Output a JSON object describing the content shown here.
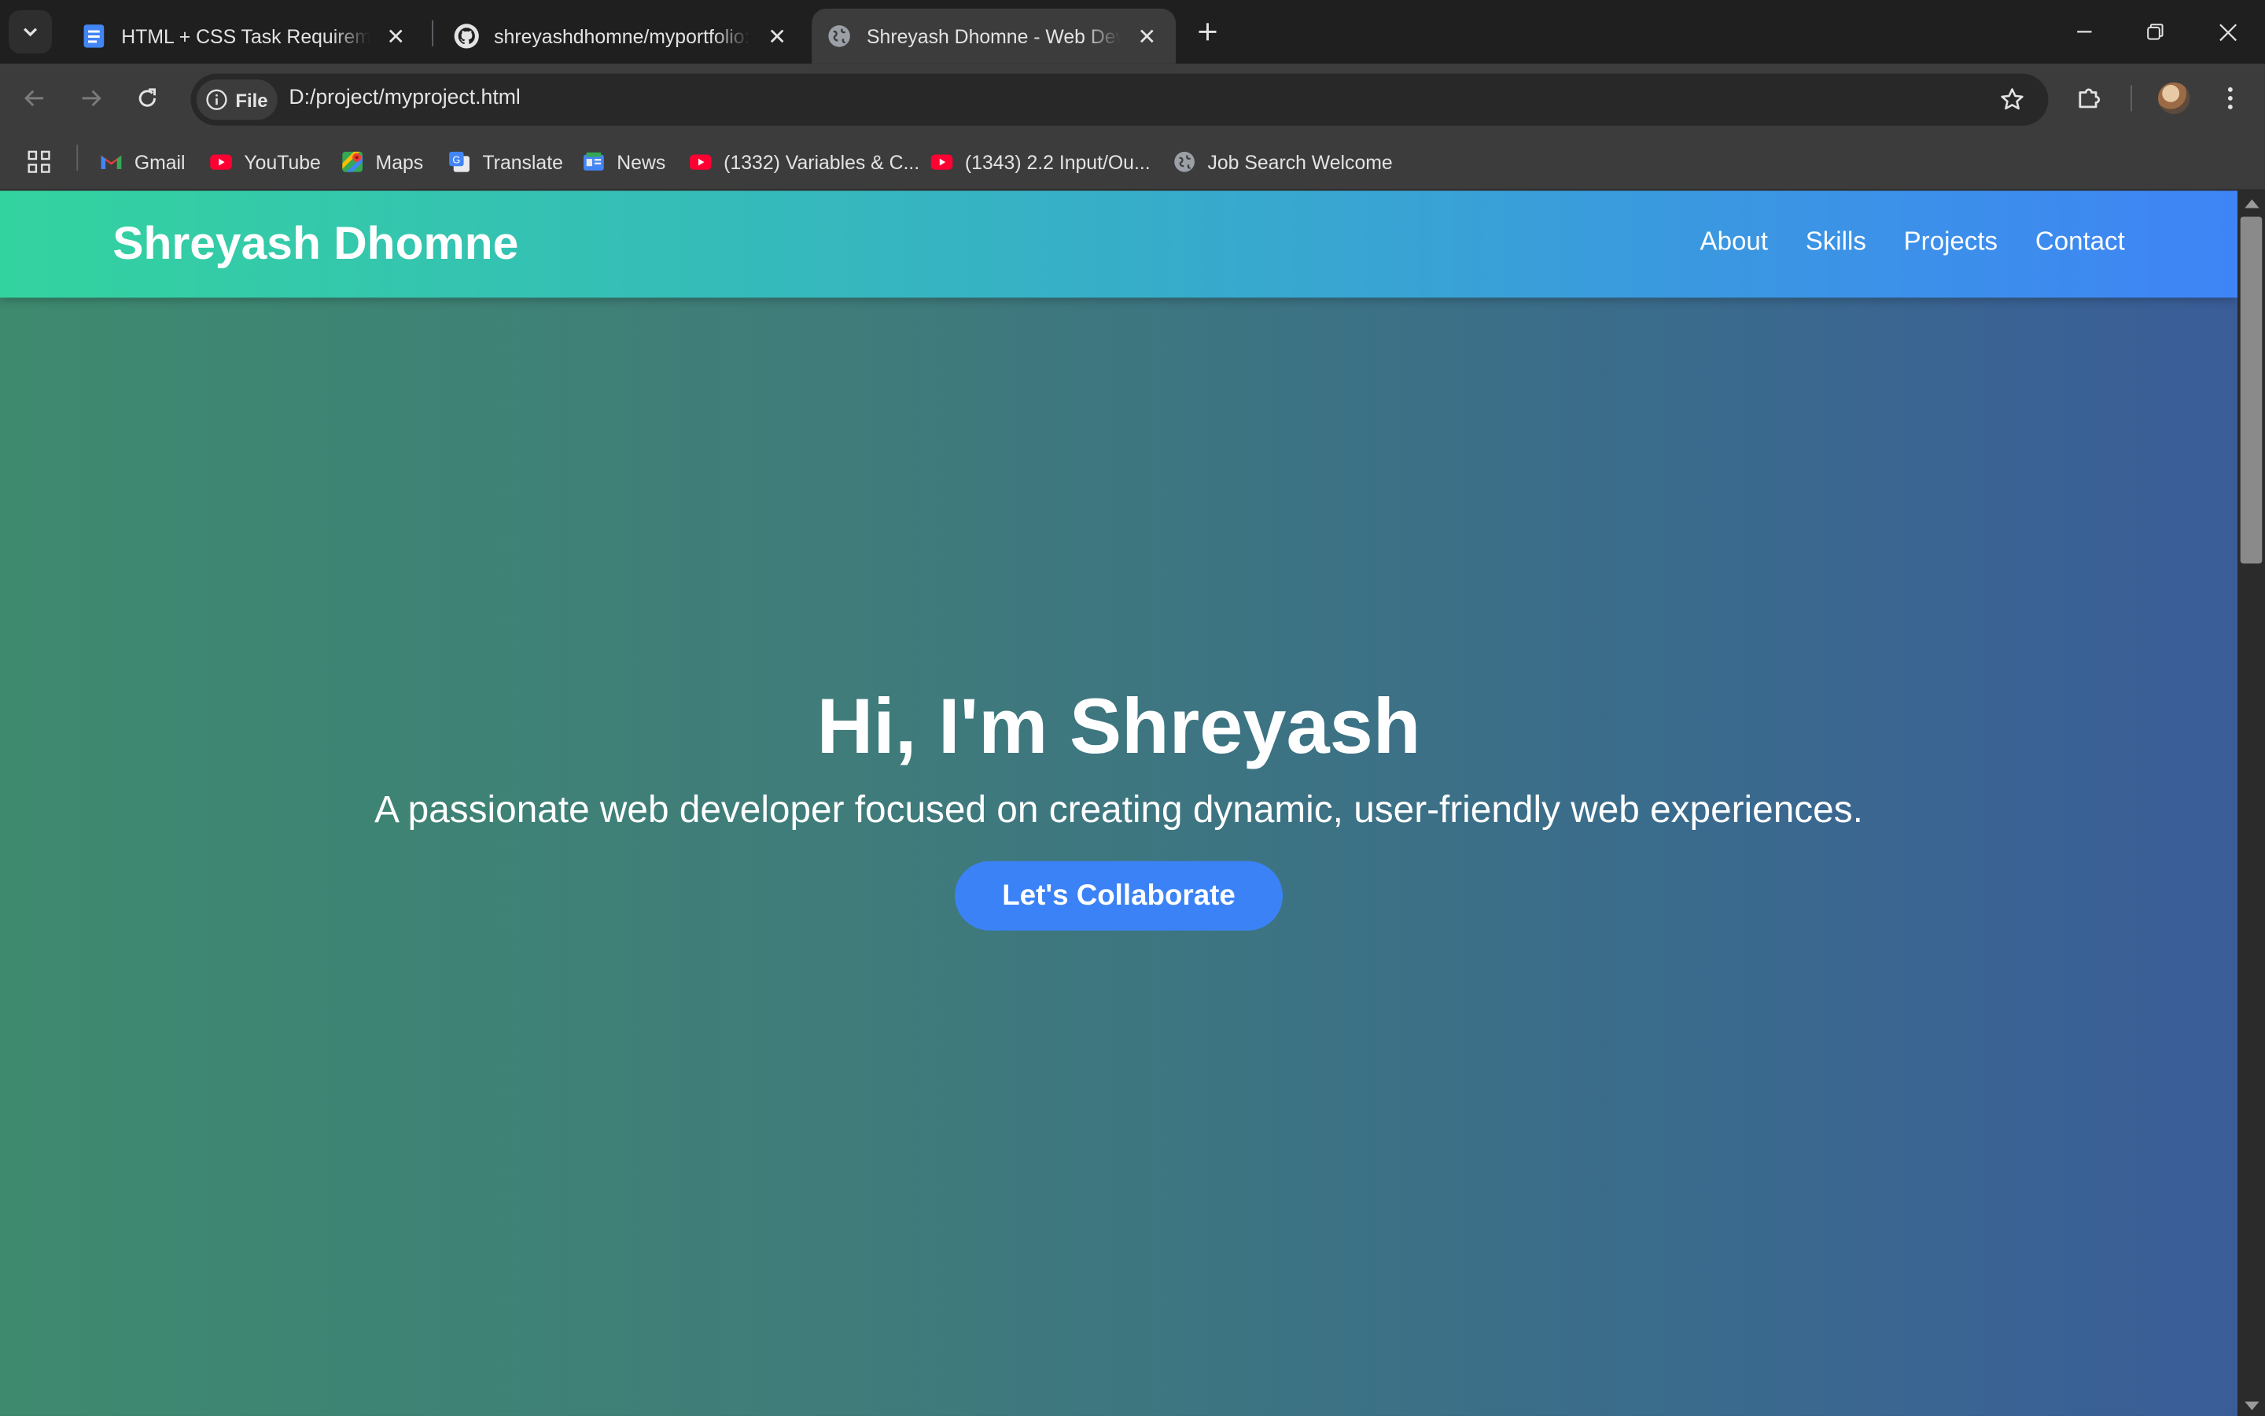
{
  "browser": {
    "tabs": [
      {
        "title": "HTML + CSS Task Requirements",
        "icon": "google-docs-icon",
        "active": false
      },
      {
        "title": "shreyashdhomne/myportfolio: P",
        "icon": "github-icon",
        "active": false
      },
      {
        "title": "Shreyash Dhomne - Web Devel",
        "icon": "globe-icon",
        "active": true
      }
    ],
    "address": {
      "chip_label": "File",
      "url": "D:/project/myproject.html"
    },
    "bookmarks": [
      {
        "label": "Gmail",
        "icon": "gmail-icon"
      },
      {
        "label": "YouTube",
        "icon": "youtube-icon"
      },
      {
        "label": "Maps",
        "icon": "maps-icon"
      },
      {
        "label": "Translate",
        "icon": "translate-icon"
      },
      {
        "label": "News",
        "icon": "news-icon"
      },
      {
        "label": "(1332) Variables & C...",
        "icon": "youtube-icon"
      },
      {
        "label": "(1343) 2.2 Input/Ou...",
        "icon": "youtube-icon"
      },
      {
        "label": "Job Search Welcome",
        "icon": "globe-icon"
      }
    ]
  },
  "site": {
    "brand": "Shreyash Dhomne",
    "nav": [
      "About",
      "Skills",
      "Projects",
      "Contact"
    ],
    "hero": {
      "title": "Hi, I'm Shreyash",
      "subtitle": "A passionate web developer focused on creating dynamic, user-friendly web experiences.",
      "cta_label": "Let's Collaborate"
    },
    "colors": {
      "header_gradient_start": "#33d39f",
      "header_gradient_end": "#3e84f6",
      "cta": "#3b82f6"
    }
  }
}
